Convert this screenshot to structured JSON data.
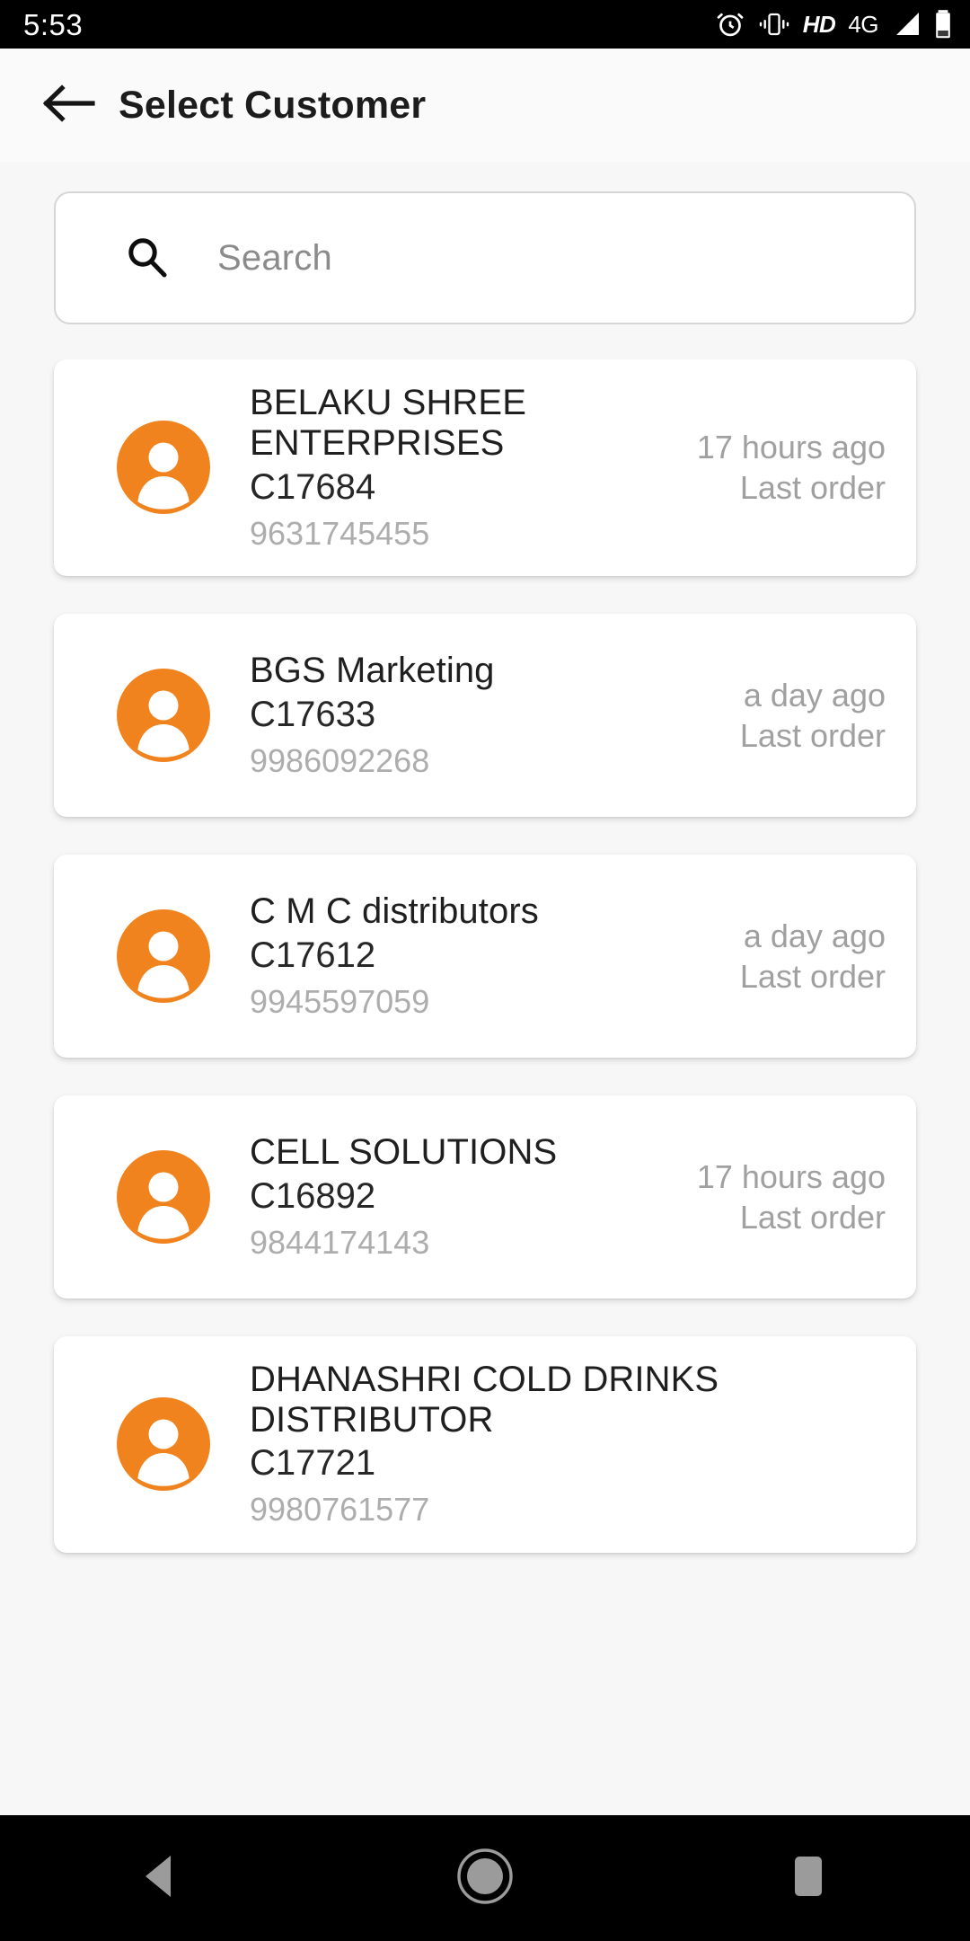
{
  "status_bar": {
    "time": "5:53",
    "icons": [
      "alarm-icon",
      "vibrate-icon",
      "hd-icon",
      "4g-icon",
      "signal-icon",
      "battery-icon"
    ],
    "hd_label": "HD",
    "network_label": "4G"
  },
  "app_bar": {
    "back_icon": "back-arrow-icon",
    "title": "Select Customer"
  },
  "search": {
    "icon": "search-icon",
    "placeholder": "Search",
    "value": ""
  },
  "colors": {
    "avatar": "#f0831e",
    "background": "#f7f7f7",
    "card": "#ffffff",
    "muted_text": "#a0a0a0",
    "phone_text": "#adadad"
  },
  "customers": [
    {
      "name": "BELAKU SHREE ENTERPRISES",
      "code": "C17684",
      "phone": "9631745455",
      "last_order_time": "17 hours ago",
      "last_order_label": "Last order"
    },
    {
      "name": "BGS Marketing",
      "code": "C17633",
      "phone": "9986092268",
      "last_order_time": "a day ago",
      "last_order_label": "Last order"
    },
    {
      "name": "C M C distributors",
      "code": "C17612",
      "phone": "9945597059",
      "last_order_time": "a day ago",
      "last_order_label": "Last order"
    },
    {
      "name": "CELL SOLUTIONS",
      "code": "C16892",
      "phone": "9844174143",
      "last_order_time": "17 hours ago",
      "last_order_label": "Last order"
    },
    {
      "name": "DHANASHRI COLD DRINKS DISTRIBUTOR",
      "code": "C17721",
      "phone": "9980761577",
      "last_order_time": "",
      "last_order_label": ""
    }
  ],
  "nav_bar": {
    "back": "nav-back-icon",
    "home": "nav-home-icon",
    "recents": "nav-recents-icon"
  }
}
